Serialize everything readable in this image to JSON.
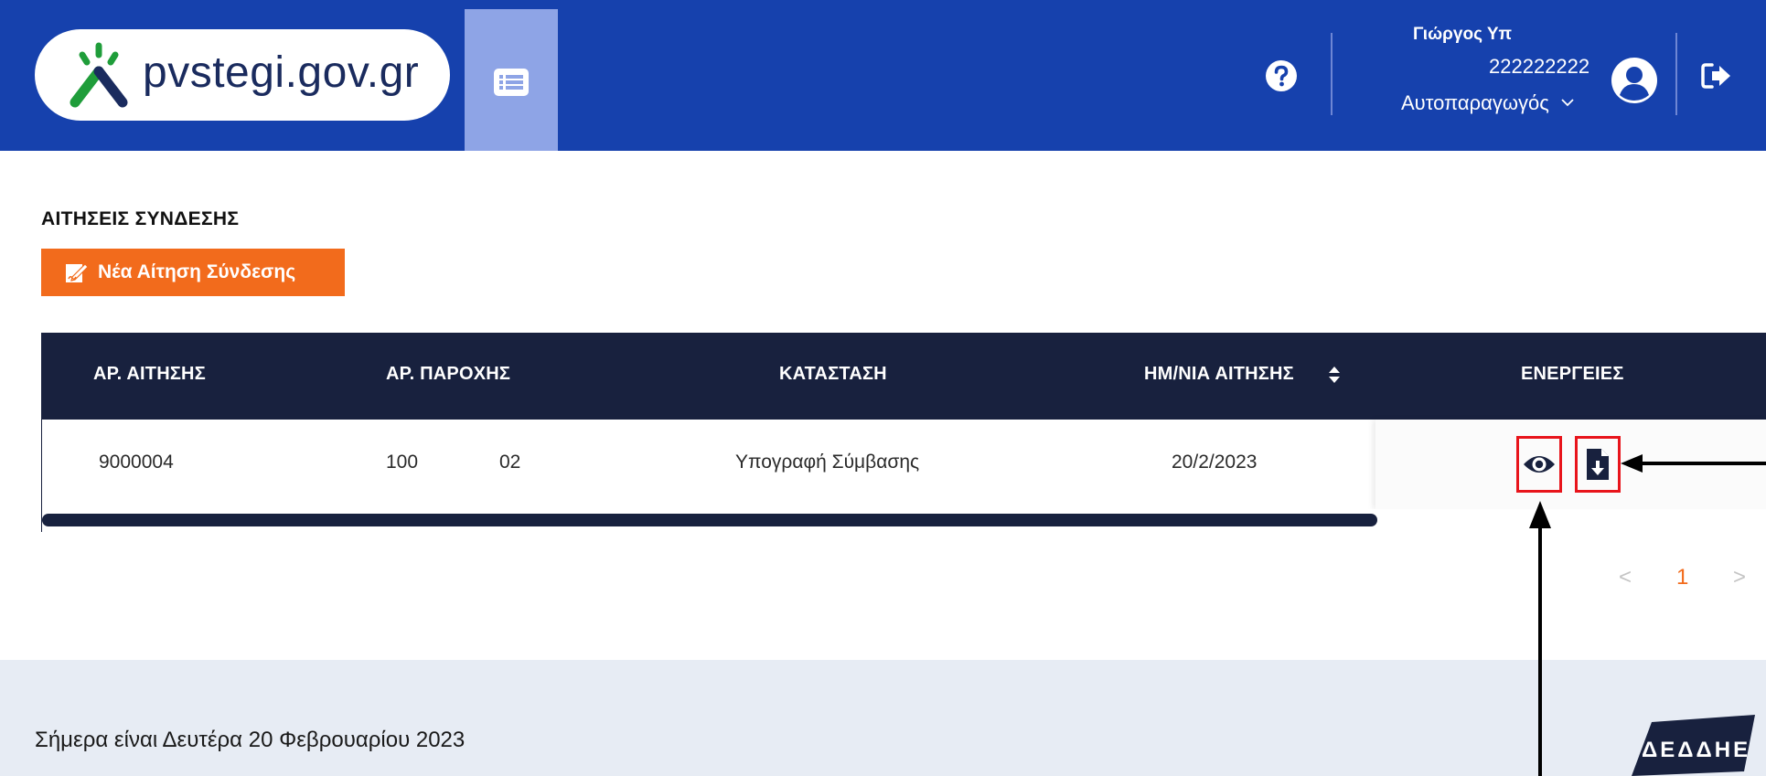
{
  "header": {
    "logo_text": "pvstegi.gov.gr",
    "user": {
      "name": "Γιώργος Υπ",
      "id": "222222222",
      "role": "Αυτοπαραγωγός"
    }
  },
  "page": {
    "title": "ΑΙΤΗΣΕΙΣ ΣΥΝΔΕΣΗΣ",
    "new_button_label": "Νέα Αίτηση Σύνδεσης"
  },
  "table": {
    "columns": [
      "ΑΡ. ΑΙΤΗΣΗΣ",
      "ΑΡ. ΠΑΡΟΧΗΣ",
      "ΚΑΤΑΣΤΑΣΗ",
      "ΗΜ/ΝΙΑ ΑΙΤΗΣΗΣ",
      "ΕΝΕΡΓΕΙΕΣ"
    ],
    "rows": [
      {
        "request_no": "9000004",
        "supply_no_start": "100",
        "supply_no_end": "02",
        "status": "Υπογραφή Σύμβασης",
        "date": "20/2/2023"
      }
    ]
  },
  "pagination": {
    "prev": "<",
    "current": "1",
    "next": ">"
  },
  "footer": {
    "date_text": "Σήμερα είναι Δευτέρα 20 Φεβρουαρίου 2023",
    "logo_text": "ΔΕΔΔΗΕ"
  },
  "icons": {
    "logo_mark": "pvstegi-logo-icon",
    "menu": "list-icon",
    "help": "question-circle-icon",
    "avatar": "user-circle-icon",
    "role_dropdown": "chevron-down-icon",
    "logout": "sign-out-icon",
    "new_request": "edit-document-icon",
    "sort": "sort-icon",
    "view": "eye-icon",
    "download": "file-download-icon"
  },
  "colors": {
    "header_bg": "#1641ad",
    "menu_tab_bg": "#8ea4e6",
    "primary_button": "#f26b1c",
    "table_header_bg": "#18213e",
    "highlight_border": "#e8141b",
    "footer_bg": "#e7ecf4",
    "active_page": "#f26b1c"
  }
}
